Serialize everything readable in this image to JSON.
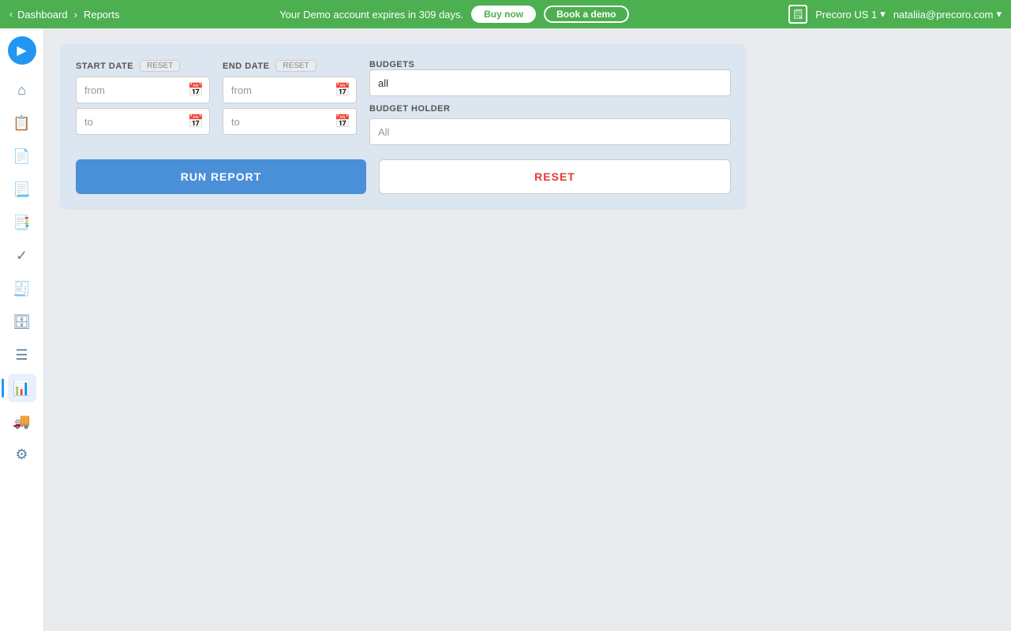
{
  "topbar": {
    "demo_message": "Your Demo account expires in 309 days.",
    "buy_now_label": "Buy now",
    "book_demo_label": "Book a demo",
    "org_name": "Precoro US 1",
    "user_email": "nataliia@precoro.com",
    "nav_dashboard": "Dashboard",
    "nav_reports": "Reports"
  },
  "sidebar": {
    "items": [
      {
        "name": "home",
        "icon": "⌂",
        "active": false
      },
      {
        "name": "purchase-orders",
        "icon": "📋",
        "active": false
      },
      {
        "name": "documents",
        "icon": "📄",
        "active": false
      },
      {
        "name": "invoices",
        "icon": "📃",
        "active": false
      },
      {
        "name": "requests",
        "icon": "📑",
        "active": false
      },
      {
        "name": "approvals",
        "icon": "✓",
        "active": false
      },
      {
        "name": "receipts",
        "icon": "🧾",
        "active": false
      },
      {
        "name": "storage",
        "icon": "🗄",
        "active": false
      },
      {
        "name": "list",
        "icon": "☰",
        "active": false
      },
      {
        "name": "reports",
        "icon": "📊",
        "active": true
      },
      {
        "name": "delivery",
        "icon": "🚚",
        "active": false
      },
      {
        "name": "connections",
        "icon": "⚙",
        "active": false
      }
    ]
  },
  "form": {
    "start_date": {
      "label": "START DATE",
      "reset_label": "RESET",
      "from_placeholder": "from",
      "to_placeholder": "to"
    },
    "end_date": {
      "label": "END DATE",
      "reset_label": "RESET",
      "from_placeholder": "from",
      "to_placeholder": "to"
    },
    "budgets": {
      "label": "BUDGETS",
      "value": "all"
    },
    "budget_holder": {
      "label": "BUDGET HOLDER",
      "placeholder": "All"
    },
    "run_report_label": "RUN REPORT",
    "reset_label": "RESET"
  },
  "icons": {
    "calendar": "📅",
    "chevron_down": "▾",
    "play": "▶",
    "back": "‹"
  }
}
